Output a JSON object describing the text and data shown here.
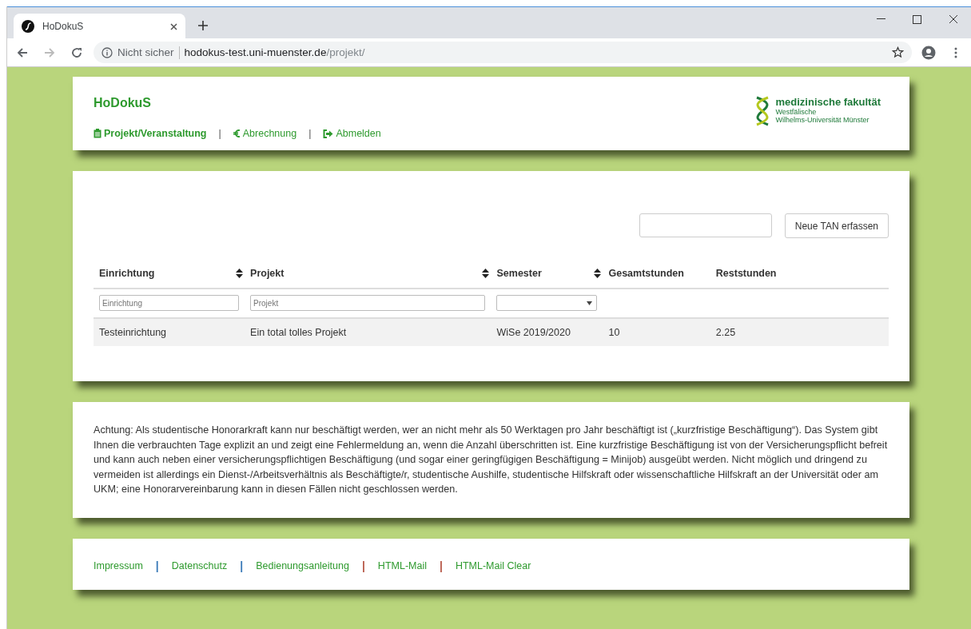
{
  "browser": {
    "tab": {
      "title": "HoDokuS",
      "selected": true
    },
    "security": "Nicht sicher",
    "url_host": "hodokus-test.uni-muenster.de",
    "url_path": "/projekt/"
  },
  "header": {
    "app_title": "HoDokuS",
    "nav": [
      {
        "label": "Projekt/Veranstaltung",
        "selected": true
      },
      {
        "label": "Abrechnung",
        "selected": false
      },
      {
        "label": "Abmelden",
        "selected": false
      }
    ],
    "separator": "|",
    "logo": {
      "title": "medizinische fakultät",
      "line_1": "Westfälische",
      "line_2": "Wilhelms-Universität Münster"
    }
  },
  "toolbar": {
    "button": "Neue TAN erfassen"
  },
  "table": {
    "columns": [
      {
        "label": "Einrichtung",
        "kind": "text",
        "sortable": true,
        "placeholder": "Einrichtung"
      },
      {
        "label": "Projekt",
        "kind": "text",
        "sortable": true,
        "placeholder": "Projekt"
      },
      {
        "label": "Semester",
        "kind": "select",
        "sortable": true
      },
      {
        "label": "Gesamtstunden",
        "kind": "plain",
        "sortable": false
      },
      {
        "label": "Reststunden",
        "kind": "plain",
        "sortable": false
      }
    ],
    "rows": [
      [
        "Testeinrichtung",
        "Ein total tolles Projekt",
        "WiSe 2019/2020",
        "10",
        "2.25"
      ]
    ]
  },
  "notice": "Achtung: Als studentische Honorarkraft kann nur beschäftigt werden, wer an nicht mehr als 50 Werktagen pro Jahr beschäftigt ist („kurzfristige Beschäftigung“). Das System gibt Ihnen die verbrauchten Tage explizit an und zeigt eine Fehlermeldung an, wenn die Anzahl überschritten ist. Eine kurzfristige Beschäftigung ist von der Versicherungspflicht befreit und kann auch neben einer versicherungspflichtigen Beschäftigung (und sogar einer geringfügigen Beschäftigung = Minijob) ausgeübt werden. Nicht möglich und dringend zu vermeiden ist allerdings ein Dienst-/Arbeitsverhältnis als Beschäftigte/r, studentische Aushilfe, studentische Hilfskraft oder wissenschaftliche Hilfskraft an der Universität oder am UKM; eine Honorarvereinbarung kann in diesen Fällen nicht geschlossen werden.",
  "footer": [
    {
      "kind": "link",
      "label": "Impressum"
    },
    {
      "kind": "separator",
      "label": "|",
      "color": "#3a7ab8"
    },
    {
      "kind": "link",
      "label": "Datenschutz"
    },
    {
      "kind": "separator",
      "label": "|",
      "color": "#3a7ab8"
    },
    {
      "kind": "link",
      "label": "Bedienungsanleitung"
    },
    {
      "kind": "separator",
      "label": "|",
      "color": "#b85a4a"
    },
    {
      "kind": "link",
      "label": "HTML-Mail"
    },
    {
      "kind": "separator",
      "label": "|",
      "color": "#b85a4a"
    },
    {
      "kind": "link",
      "label": "HTML-Mail Clear"
    }
  ]
}
